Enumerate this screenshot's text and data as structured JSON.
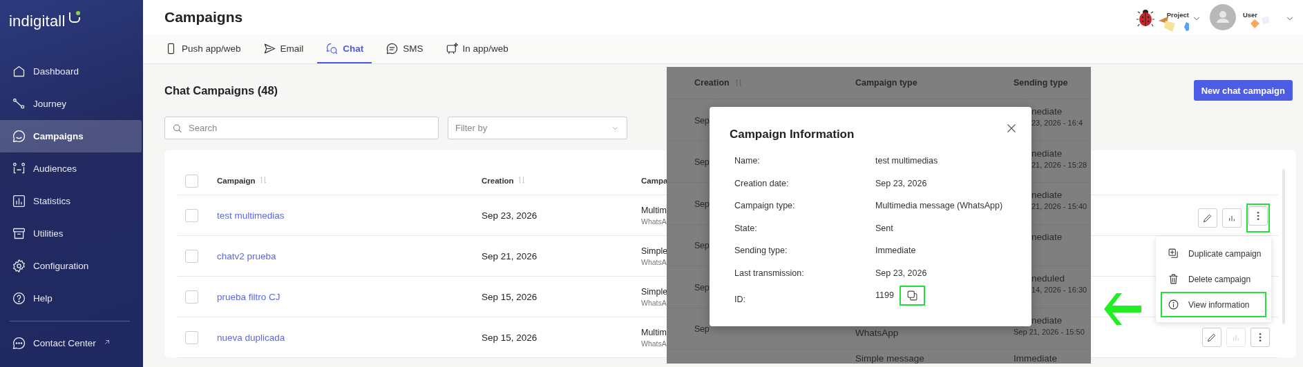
{
  "sidebar": {
    "logo": "indigitall",
    "items": [
      {
        "label": "Dashboard",
        "selected": false
      },
      {
        "label": "Journey",
        "selected": false
      },
      {
        "label": "Campaigns",
        "selected": true
      },
      {
        "label": "Audiences",
        "selected": false
      },
      {
        "label": "Statistics",
        "selected": false
      },
      {
        "label": "Utilities",
        "selected": false
      },
      {
        "label": "Configuration",
        "selected": false
      },
      {
        "label": "Help",
        "selected": false
      }
    ],
    "footer_item": {
      "label": "Contact Center",
      "external": true
    }
  },
  "header": {
    "title": "Campaigns",
    "project_label": "Project",
    "user_label": "User"
  },
  "tabs": [
    {
      "label": "Push app/web",
      "selected": false
    },
    {
      "label": "Email",
      "selected": false
    },
    {
      "label": "Chat",
      "selected": true
    },
    {
      "label": "SMS",
      "selected": false
    },
    {
      "label": "In app/web",
      "selected": false
    }
  ],
  "section": {
    "title": "Chat Campaigns (48)",
    "new_button": "New chat campaign",
    "search": {
      "placeholder": "Search"
    },
    "filter": {
      "placeholder": "Filter by"
    }
  },
  "table": {
    "select_all": {
      "checked": false
    },
    "columns": [
      {
        "label": "Campaign",
        "sortable": true
      },
      {
        "label": "Creation",
        "sortable": true
      },
      {
        "label": "Campa",
        "sortable": false
      }
    ],
    "rows": [
      {
        "checked": false,
        "name": "test multimedias",
        "creation": "Sep 23, 2026",
        "type": "Multim",
        "channel": "WhatsA",
        "actions": {
          "highlighted": true,
          "stats_disabled": false
        }
      },
      {
        "checked": false,
        "name": "chatv2 prueba",
        "creation": "Sep 21, 2026",
        "type": "Simple",
        "channel": "WhatsA"
      },
      {
        "checked": false,
        "name": "prueba filtro CJ",
        "creation": "Sep 15, 2026",
        "type": "Simple",
        "channel": "WhatsA"
      },
      {
        "checked": false,
        "name": "nueva duplicada",
        "creation": "Sep 15, 2026",
        "type": "Multim",
        "channel": "WhatsA",
        "actions": {
          "highlighted": false,
          "stats_disabled": true
        }
      }
    ]
  },
  "background_table": {
    "columns": [
      {
        "label": "Creation",
        "sortable": true
      },
      {
        "label": "Campaign type",
        "sortable": false
      },
      {
        "label": "Sending type",
        "sortable": false
      }
    ],
    "rows": [
      {
        "creation": "Sep",
        "sending": "nediate",
        "sending_date": "23, 2026 - 16:4"
      },
      {
        "creation": "Sep",
        "sending": "nediate",
        "sending_date": "21, 2026 - 15:28"
      },
      {
        "creation": "Sep",
        "sending": "nediate",
        "sending_date": "21, 2026 - 15:40"
      },
      {
        "creation": "Sep",
        "sending": "nediate"
      },
      {
        "creation": "Sep",
        "sending": "neduled",
        "sending_date": "14, 2026 - 16:30"
      },
      {
        "creation": "Sep",
        "channel": "WhatsApp",
        "sending": "nediate",
        "sending_date": "Sep 21, 2026 - 15:50"
      },
      {
        "type": "Simple message",
        "sending": "Immediate"
      }
    ]
  },
  "menu": {
    "items": [
      {
        "label": "Duplicate campaign",
        "highlighted": false
      },
      {
        "label": "Delete campaign",
        "highlighted": false
      },
      {
        "label": "View information",
        "highlighted": true
      }
    ]
  },
  "modal": {
    "title": "Campaign Information",
    "fields": [
      {
        "label": "Name:",
        "value": "test multimedias"
      },
      {
        "label": "Creation date:",
        "value": "Sep 23, 2026"
      },
      {
        "label": "Campaign type:",
        "value": "Multimedia message (WhatsApp)"
      },
      {
        "label": "State:",
        "value": "Sent"
      },
      {
        "label": "Sending type:",
        "value": "Immediate"
      },
      {
        "label": "Last transmission:",
        "value": "Sep 23, 2026"
      },
      {
        "label": "ID:",
        "value": "1199",
        "copyable": true,
        "highlighted": true
      }
    ]
  },
  "annotation_arrow": true
}
